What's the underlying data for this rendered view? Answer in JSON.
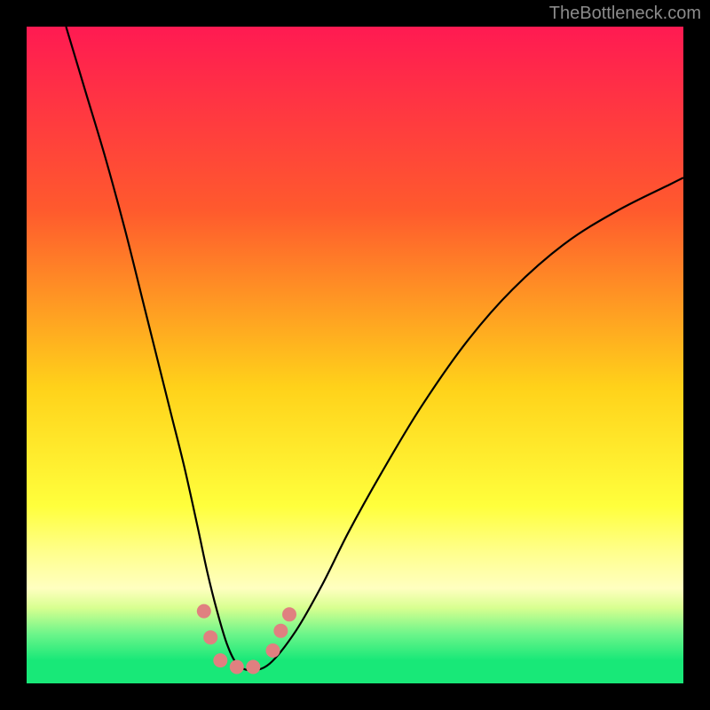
{
  "watermark": "TheBottleneck.com",
  "chart_data": {
    "type": "line",
    "title": "",
    "xlabel": "",
    "ylabel": "",
    "xlim": [
      0,
      100
    ],
    "ylim": [
      0,
      100
    ],
    "grid": false,
    "legend": false,
    "background_gradient": {
      "stops": [
        {
          "offset": 0.0,
          "color": "#ff1a52"
        },
        {
          "offset": 0.28,
          "color": "#ff5a2d"
        },
        {
          "offset": 0.55,
          "color": "#ffd21a"
        },
        {
          "offset": 0.73,
          "color": "#ffff3c"
        },
        {
          "offset": 0.8,
          "color": "#ffff8c"
        },
        {
          "offset": 0.855,
          "color": "#ffffc0"
        },
        {
          "offset": 0.885,
          "color": "#d8ff90"
        },
        {
          "offset": 0.925,
          "color": "#6cf58a"
        },
        {
          "offset": 0.965,
          "color": "#18e878"
        },
        {
          "offset": 1.0,
          "color": "#18e878"
        }
      ]
    },
    "series": [
      {
        "name": "bottleneck-curve",
        "color": "#000000",
        "x": [
          6,
          9,
          12,
          15,
          18,
          20,
          22,
          24,
          26,
          27.5,
          29,
          30.5,
          32,
          34,
          37,
          41,
          45,
          49,
          54,
          60,
          67,
          74,
          82,
          90,
          98,
          100
        ],
        "y": [
          100,
          90,
          80,
          69,
          57,
          49,
          41,
          33,
          24,
          17,
          11,
          6,
          3,
          2,
          3,
          8,
          15,
          23,
          32,
          42,
          52,
          60,
          67,
          72,
          76,
          77
        ]
      }
    ],
    "markers": {
      "name": "highlight-points",
      "color": "#e08080",
      "radius": 8,
      "points": [
        {
          "x": 27.0,
          "y": 11.0
        },
        {
          "x": 28.0,
          "y": 7.0
        },
        {
          "x": 29.5,
          "y": 3.5
        },
        {
          "x": 32.0,
          "y": 2.5
        },
        {
          "x": 34.5,
          "y": 2.5
        },
        {
          "x": 37.5,
          "y": 5.0
        },
        {
          "x": 38.7,
          "y": 8.0
        },
        {
          "x": 40.0,
          "y": 10.5
        }
      ]
    }
  }
}
